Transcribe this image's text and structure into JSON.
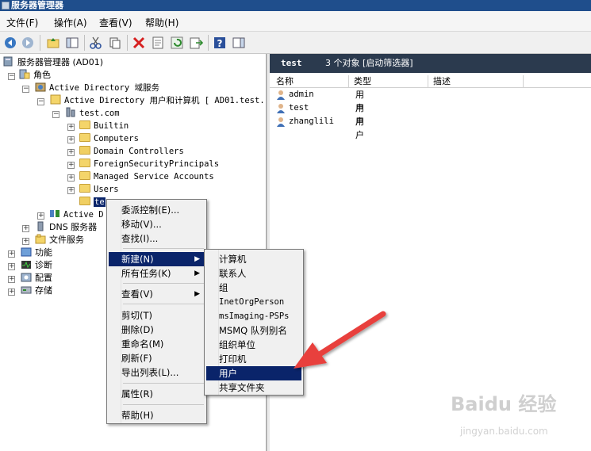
{
  "window": {
    "title": "服务器管理器"
  },
  "menu": [
    "文件(F)",
    "操作(A)",
    "查看(V)",
    "帮助(H)"
  ],
  "tree": {
    "root": "服务器管理器 (AD01)",
    "roles": "角色",
    "adds": "Active Directory 域服务",
    "aduc": "Active Directory 用户和计算机 [ AD01.test.",
    "domain": "test.com",
    "builtin": "Builtin",
    "computers": "Computers",
    "dcs": "Domain Controllers",
    "fsp": "ForeignSecurityPrincipals",
    "msa": "Managed Service Accounts",
    "users": "Users",
    "test_ou": "te",
    "ad_sites": "Active D",
    "dns": "DNS 服务器",
    "file": "文件服务",
    "features": "功能",
    "diagnostics": "诊断",
    "configuration": "配置",
    "storage": "存储"
  },
  "right": {
    "title": "test",
    "count": "3 个对象 [启动筛选器]",
    "columns": [
      "名称",
      "类型",
      "描述"
    ],
    "rows": [
      {
        "name": "admin",
        "type": "用户"
      },
      {
        "name": "test",
        "type": "用户"
      },
      {
        "name": "zhanglili",
        "type": "用户"
      }
    ]
  },
  "context_menu": [
    "委派控制(E)...",
    "移动(V)...",
    "查找(I)...",
    "新建(N)",
    "所有任务(K)",
    "查看(V)",
    "剪切(T)",
    "删除(D)",
    "重命名(M)",
    "刷新(F)",
    "导出列表(L)...",
    "属性(R)",
    "帮助(H)"
  ],
  "submenu": [
    "计算机",
    "联系人",
    "组",
    "InetOrgPerson",
    "msImaging-PSPs",
    "MSMQ 队列别名",
    "组织单位",
    "打印机",
    "用户",
    "共享文件夹"
  ],
  "watermark": {
    "brand": "Baidu 经验",
    "url": "jingyan.baidu.com"
  },
  "colors": {
    "highlight": "#0a246a",
    "arrow": "#e8413c",
    "header": "#2b3a4e"
  }
}
